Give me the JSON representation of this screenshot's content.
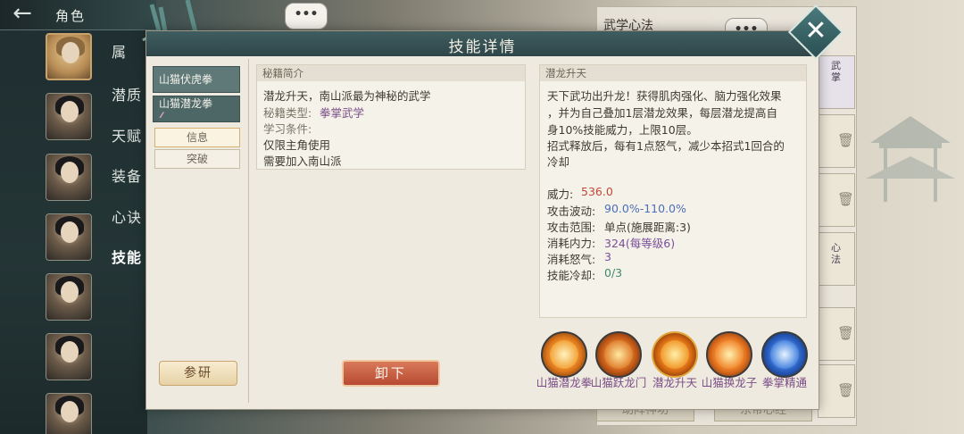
{
  "header": {
    "back_label": "←",
    "title": "角色"
  },
  "sidebar_tabs": [
    "属",
    "潜质",
    "天赋",
    "装备",
    "心诀",
    "技能"
  ],
  "background_panel": {
    "title": "武学心法",
    "bottom_left": "助阵神功",
    "bottom_right": "东帝心经",
    "slot_label_1": "武掌",
    "slot_label_2": "心法"
  },
  "chat_bubble": "•••",
  "modal": {
    "title": "技能详情",
    "close_label": "✕",
    "skill_tabs": [
      {
        "label": "山猫伏虎拳",
        "stars": ""
      },
      {
        "label": "山猫潜龙拳",
        "stars": "⁄⁄⁄"
      }
    ],
    "info_tabs": [
      "信息",
      "突破"
    ],
    "study_button": "参研",
    "unequip_button": "卸下",
    "secret_section": {
      "title": "秘籍简介",
      "line1": "潜龙升天，南山派最为神秘的武学",
      "type_label": "秘籍类型:",
      "type_value": "拳掌武学",
      "cond_label": "学习条件:",
      "cond1": "仅限主角使用",
      "cond2": "需要加入南山派"
    },
    "skill_section": {
      "title": "潜龙升天",
      "desc": [
        "天下武功出升龙！获得肌肉强化、脑力强化效果",
        "，并为自己叠加1层潜龙效果，每层潜龙提高自",
        "身10%技能威力，上限10层。",
        "招式释放后，每有1点怒气，减少本招式1回合的",
        "冷却"
      ],
      "stats": [
        {
          "label": "威力:",
          "value": "536.0",
          "color": "#c0493a"
        },
        {
          "label": "攻击波动:",
          "value": "90.0%-110.0%",
          "color": "#4d6fb8"
        },
        {
          "label": "攻击范围:",
          "value": "单点(施展距离:3)",
          "color": "#3f3a31"
        },
        {
          "label": "消耗内力:",
          "value": "324(每等级6)",
          "color": "#7a4f98"
        },
        {
          "label": "消耗怒气:",
          "value": "3",
          "color": "#7a4f98"
        },
        {
          "label": "技能冷却:",
          "value": "0/3",
          "color": "#3f8a6a"
        }
      ]
    },
    "skill_icons": [
      {
        "name": "山猫潜龙拳"
      },
      {
        "name": "山猫跃龙门"
      },
      {
        "name": "潜龙升天"
      },
      {
        "name": "山猫换龙子"
      },
      {
        "name": "拳掌精通"
      }
    ]
  },
  "colors": {
    "modal_header": "#3f5d60",
    "accent_gold": "#c9a36b",
    "danger_button": "#b84a33",
    "skill_name": "#7a4d86"
  }
}
